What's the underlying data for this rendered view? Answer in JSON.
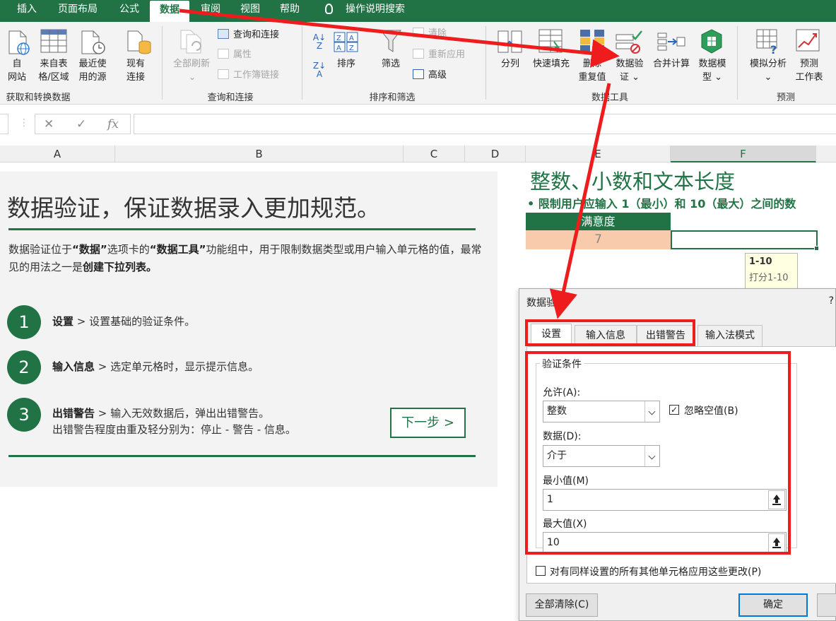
{
  "tabs": [
    {
      "label": "插入"
    },
    {
      "label": "页面布局"
    },
    {
      "label": "公式"
    },
    {
      "label": "数据"
    },
    {
      "label": "审阅"
    },
    {
      "label": "视图"
    },
    {
      "label": "帮助"
    },
    {
      "label": "操作说明搜索"
    }
  ],
  "active_tab": "数据",
  "ribbon": {
    "get_data": {
      "from_web": "自\n网站",
      "from_table": "来自表\n格/区域",
      "recent_sources": "最近使\n用的源",
      "existing_connections": "现有\n连接",
      "group_label": "获取和转换数据"
    },
    "queries": {
      "refresh_all": "全部刷新",
      "queries_connections": "查询和连接",
      "properties": "属性",
      "edit_links": "工作簿链接",
      "group_label": "查询和连接"
    },
    "sort_filter": {
      "sort": "排序",
      "filter": "筛选",
      "clear": "清除",
      "reapply": "重新应用",
      "advanced": "高级",
      "group_label": "排序和筛选"
    },
    "data_tools": {
      "text_to_columns": "分列",
      "flash_fill": "快速填充",
      "remove_duplicates": "删除\n重复值",
      "data_validation": "数据验\n证 ⌄",
      "consolidate": "合并计算",
      "data_model": "数据模\n型 ⌄",
      "group_label": "数据工具"
    },
    "forecast": {
      "what_if": "模拟分析\n⌄",
      "forecast_sheet": "预测\n工作表",
      "group_label": "预测"
    }
  },
  "formula_bar": {
    "cancel": "✕",
    "enter": "✓",
    "fx": "fx",
    "value": ""
  },
  "columns": [
    "A",
    "B",
    "C",
    "D",
    "E",
    "F"
  ],
  "panel": {
    "title": "数据验证，保证数据录入更加规范。",
    "desc_a": "数据验证位于",
    "desc_b": "“数据”",
    "desc_c": "选项卡的",
    "desc_d": "“数据工具”",
    "desc_e": "功能组中，用于限制数据类型或用户输入单元格的值，最常见的用法之一是",
    "desc_f": "创建下拉列表。",
    "steps": [
      {
        "num": "1",
        "title": "设置",
        "text": " > 设置基础的验证条件。",
        "text2": ""
      },
      {
        "num": "2",
        "title": "输入信息",
        "text": " > 选定单元格时，显示提示信息。",
        "text2": ""
      },
      {
        "num": "3",
        "title": "出错警告",
        "text": " > 输入无效数据后，弹出出错警告。",
        "text2": "出错警告程度由重及轻分别为：停止 - 警告 - 信息。"
      }
    ],
    "next_button": "下一步 >"
  },
  "sheet": {
    "heading": "整数、小数和文本长度",
    "subheading": "• 限制用户应输入 1（最小）和 10（最大）之间的数",
    "table_header": "满意度",
    "table_value": "7",
    "tooltip_title": "1-10",
    "tooltip_body": "打分1-10"
  },
  "dialog": {
    "title": "数据验证",
    "help": "?",
    "tabs": [
      "设置",
      "输入信息",
      "出错警告",
      "输入法模式"
    ],
    "legend": "验证条件",
    "allow_label": "允许(A):",
    "allow_value": "整数",
    "ignore_blank_label": "忽略空值(B)",
    "ignore_blank_checked": true,
    "data_label": "数据(D):",
    "data_value": "介于",
    "min_label": "最小值(M)",
    "min_value": "1",
    "max_label": "最大值(X)",
    "max_value": "10",
    "apply_all_label": "对有同样设置的所有其他单元格应用这些更改(P)",
    "clear_all": "全部清除(C)",
    "ok": "确定"
  },
  "colors": {
    "brand_green": "#217346",
    "annotation_red": "#ee1c1c",
    "cell_orange": "#f8cbad",
    "tooltip_bg": "#ffffe1"
  },
  "icons": {
    "tell_me": "lightbulb-icon",
    "ref_button": "collapse-dialog-icon"
  }
}
